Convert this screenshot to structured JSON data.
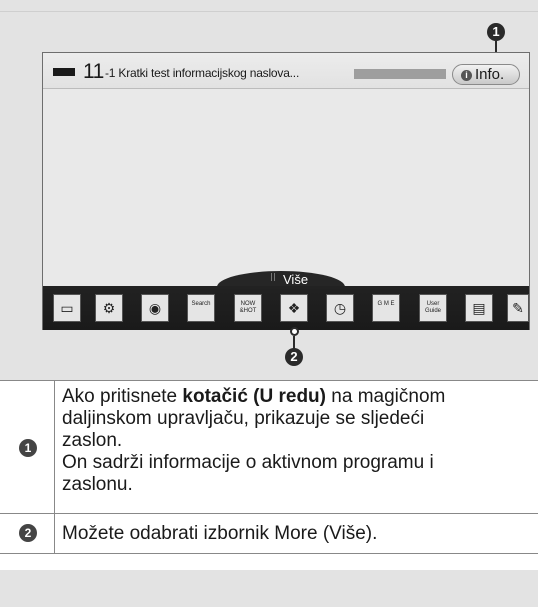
{
  "tv": {
    "channel_number": "11",
    "channel_title": "-1 Kratki test informacijskog naslova...",
    "info_button_label": "Info.",
    "info_icon_glyph": "i",
    "more_label": "Više"
  },
  "launcher_apps": [
    {
      "icon": "tv-input-icon",
      "label": "",
      "glyph": "▭"
    },
    {
      "icon": "settings-gear-icon",
      "label": "",
      "glyph": "⚙"
    },
    {
      "icon": "globe-icon",
      "label": "",
      "glyph": "◉"
    },
    {
      "icon": "search-icon",
      "label": "Search",
      "glyph": ""
    },
    {
      "icon": "now-hot-icon",
      "label": "NOW &HOT",
      "glyph": ""
    },
    {
      "icon": "apps-icon",
      "label": "",
      "glyph": "❖"
    },
    {
      "icon": "clock-icon",
      "label": "",
      "glyph": "◷"
    },
    {
      "icon": "game-icon",
      "label": "G M E",
      "glyph": ""
    },
    {
      "icon": "user-guide-icon",
      "label": "User Guide",
      "glyph": ""
    },
    {
      "icon": "media-icon",
      "label": "",
      "glyph": "▤"
    },
    {
      "icon": "edit-icon",
      "label": "",
      "glyph": "✎"
    }
  ],
  "callouts": {
    "one": "1",
    "two": "2"
  },
  "table": {
    "row1": {
      "number": "1",
      "line1_pre": "Ako pritisnete ",
      "line1_bold": "kotačić (U redu)",
      "line1_post": " na magičnom",
      "line2": "daljinskom upravljaču, prikazuje se sljedeći",
      "line3": "zaslon.",
      "line4": "On sadrži informacije o aktivnom programu i",
      "line5": "zaslonu."
    },
    "row2": {
      "number": "2",
      "text": "Možete odabrati izbornik More (Više)."
    }
  },
  "colors": {
    "page_bg": "#e3e3e3",
    "launcher_bg": "#1e1e1e",
    "callout": "#2a2a2a"
  }
}
